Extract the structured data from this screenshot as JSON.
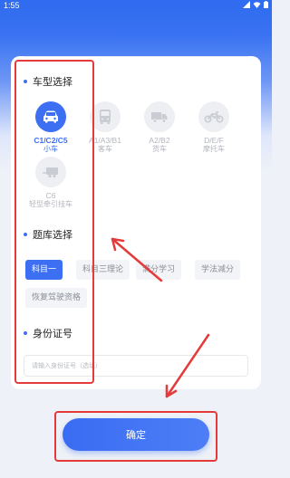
{
  "status_bar": {
    "time": "1:55"
  },
  "sections": {
    "vehicle_type": "车型选择",
    "question_bank": "题库选择",
    "id_number": "身份证号"
  },
  "vehicle_types": [
    {
      "code": "C1/C2/C5",
      "name": "小车",
      "icon": "car-icon",
      "active": true
    },
    {
      "code": "A1/A3/B1",
      "name": "客车",
      "icon": "bus-icon",
      "active": false
    },
    {
      "code": "A2/B2",
      "name": "货车",
      "icon": "truck-icon",
      "active": false
    },
    {
      "code": "D/E/F",
      "name": "摩托车",
      "icon": "motorcycle-icon",
      "active": false
    },
    {
      "code": "C6",
      "name": "轻型牵引挂车",
      "icon": "trailer-icon",
      "active": false
    }
  ],
  "question_banks": [
    {
      "label": "科目一",
      "active": true
    },
    {
      "label": "科目三理论",
      "active": false
    },
    {
      "label": "满分学习",
      "active": false
    },
    {
      "label": "学法减分",
      "active": false
    },
    {
      "label": "恢复驾驶资格",
      "active": false
    }
  ],
  "id_input": {
    "value": "",
    "placeholder": "请输入身份证号（选填）"
  },
  "confirm_label": "确定",
  "colors": {
    "accent": "#3d6ff2",
    "annotation": "#e53a3a",
    "inactive_text": "#b3b6bd"
  }
}
